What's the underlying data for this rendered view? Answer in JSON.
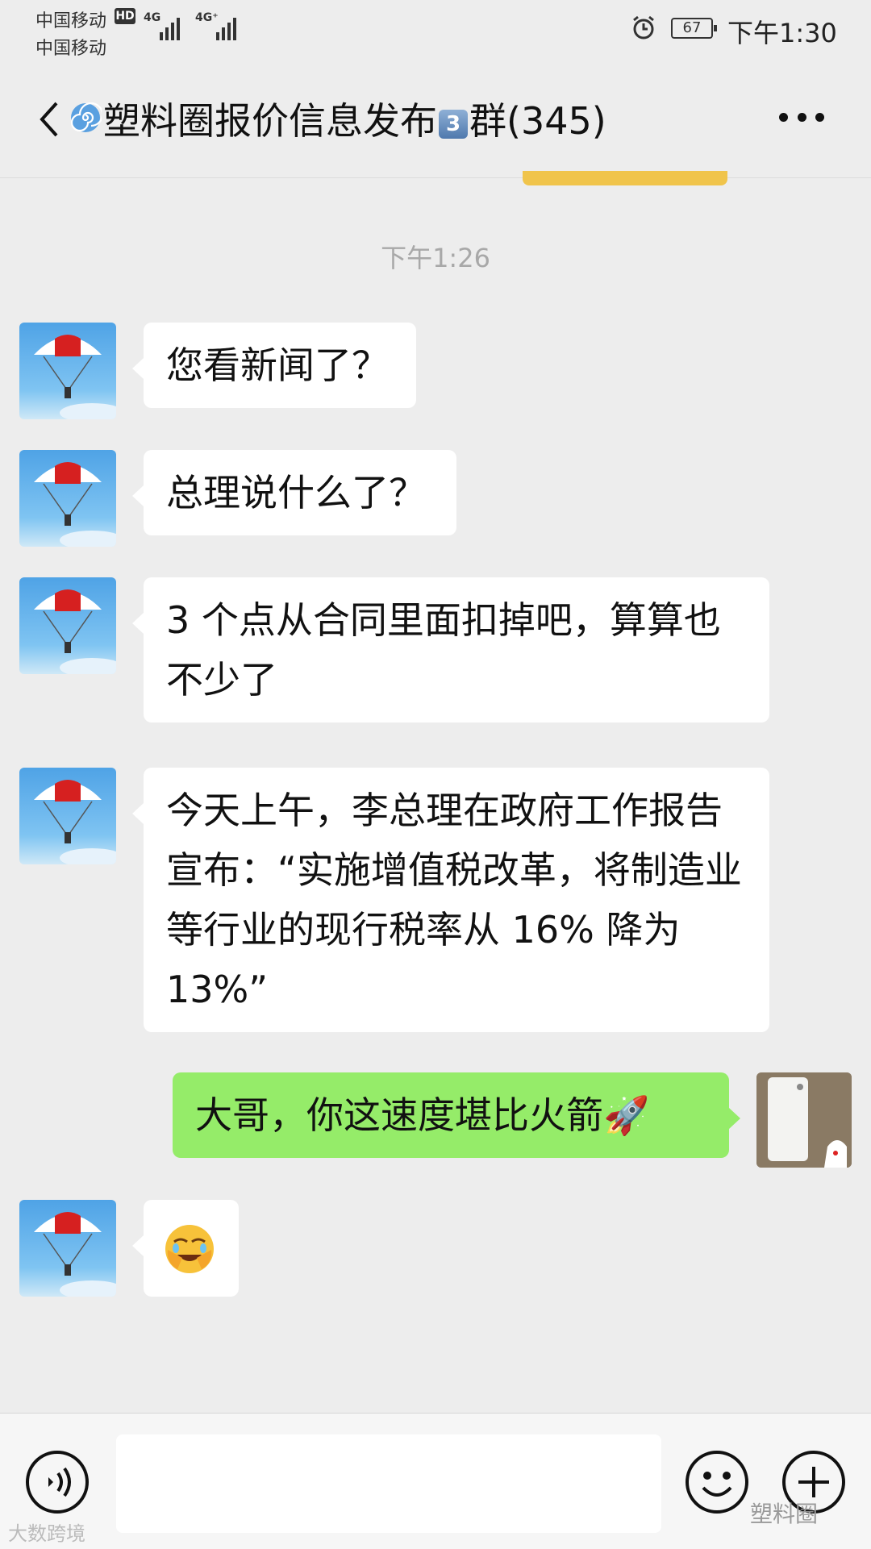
{
  "status_bar": {
    "carrier_1": "中国移动",
    "carrier_2": "中国移动",
    "hd": "HD",
    "net_1": "4G",
    "net_2": "4G⁺",
    "battery": "67",
    "time": "下午1:30"
  },
  "header": {
    "title_part1": "塑料圈报价信息发布",
    "title_badge": "3",
    "title_part2": "群(345)"
  },
  "chat": {
    "timestamp": "下午1:26",
    "messages": [
      {
        "sender": "other",
        "text": "您看新闻了？"
      },
      {
        "sender": "other",
        "text": "总理说什么了？"
      },
      {
        "sender": "other",
        "text": "3 个点从合同里面扣掉吧，算算也不少了"
      },
      {
        "sender": "other",
        "text": "今天上午，李总理在政府工作报告宣布：“实施增值税改革，将制造业等行业的现行税率从 16% 降为 13%”"
      },
      {
        "sender": "me",
        "text": "大哥，你这速度堪比火箭🚀"
      },
      {
        "sender": "other",
        "text": "",
        "emoji": "facepalm-laughing-emoji"
      }
    ]
  },
  "input_bar": {
    "placeholder": ""
  },
  "watermarks": {
    "left": "大数跨境",
    "right": "塑料圈"
  },
  "colors": {
    "background": "#ededed",
    "my_bubble": "#95ec69",
    "other_bubble": "#ffffff"
  }
}
